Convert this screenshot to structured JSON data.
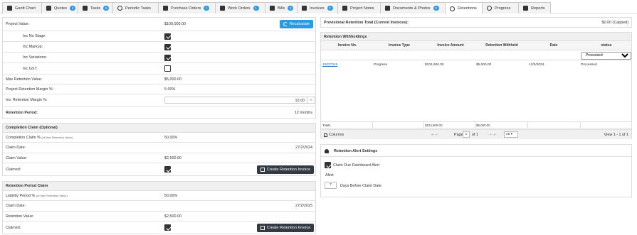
{
  "tabs": [
    {
      "label": "Gantt Chart",
      "icon": "gantt-icon",
      "badge": null
    },
    {
      "label": "Quotes",
      "icon": "quotes-icon",
      "badge": "2"
    },
    {
      "label": "Tasks",
      "icon": "tasks-icon",
      "badge": "6"
    },
    {
      "label": "Periodic Tasks",
      "icon": "periodic-tasks-icon",
      "badge": null
    },
    {
      "label": "Purchase Orders",
      "icon": "cart-icon",
      "badge": "1"
    },
    {
      "label": "Work Orders",
      "icon": "cart-icon",
      "badge": "1"
    },
    {
      "label": "Bills",
      "icon": "cart-icon",
      "badge": "2"
    },
    {
      "label": "Invoices",
      "icon": "invoices-icon",
      "badge": "2"
    },
    {
      "label": "Project Notes",
      "icon": "notes-icon",
      "badge": null
    },
    {
      "label": "Documents & Photos",
      "icon": "documents-icon",
      "badge": "0"
    },
    {
      "label": "Retentions",
      "icon": "sync-icon",
      "badge": null
    },
    {
      "label": "Progress",
      "icon": "progress-icon",
      "badge": null
    },
    {
      "label": "Reports",
      "icon": "reports-icon",
      "badge": null
    }
  ],
  "retention": {
    "project_value_label": "Project Value:",
    "project_value": "$100,000.00",
    "recalculate_label": "Recalculate",
    "inc_no_stage_label": "Inc No Stage:",
    "inc_markup_label": "Inc Markup:",
    "inc_variations_label": "Inc Variations:",
    "inc_gst_label": "Inc GST:",
    "max_retention_label": "Max Retention Value:",
    "max_retention_value": "$5,000.00",
    "margin_label": "Project Retention Margin %:",
    "margin_value": "5.00%",
    "inv_margin_label": "Inv. Retention Margin %:",
    "inv_margin_value": "10.00",
    "pct_symbol": "%",
    "period_label": "Retention Period:",
    "period_value": "12 months"
  },
  "completion": {
    "header": "Completion Claim (Optional)",
    "claim_pct_label": "Completion Claim %",
    "claim_pct_note": "(of Max Retention Value)",
    "claim_pct_value": "50.00%",
    "claim_date_label": "Claim Date:",
    "claim_date_value": "27/2/2024",
    "claim_value_label": "Claim Value:",
    "claim_value_value": "$2,500.00",
    "claimed_label": "Claimed:",
    "create_label": "Create Retention Invoice"
  },
  "period_claim": {
    "header": "Retention Period Claim",
    "liability_label": "Liability Period %",
    "liability_note": "(of Max Retention Value)",
    "liability_value": "50.00%",
    "claim_date_label": "Claim Date:",
    "claim_date_value": "27/2/2025",
    "retention_value_label": "Retention Value:",
    "retention_value_value": "$2,500.00",
    "claimed_label": "Claimed:",
    "create_label": "Create Retention Invoice"
  },
  "provisional": {
    "label": "Provisional Retention Total (Current Invoices):",
    "value": "$0.00 (Capped)"
  },
  "withholdings": {
    "title": "Retention Withholdings",
    "columns": [
      "Invoice No.",
      "Invoice Type",
      "Invoice Amount",
      "Retention Withheld",
      "Date",
      "status"
    ],
    "status_filter": "Processed",
    "rows": [
      {
        "invoice_no": "10027349",
        "type": "Progress",
        "amount": "$104,500.00",
        "withheld": "$5,000.00",
        "date": "12/3/2024",
        "status": "Processed"
      }
    ],
    "totals_label": "Totals",
    "total_amount": "$104,500.00",
    "total_withheld": "$5,000.00",
    "columns_label": "Columns",
    "page_label": "Page",
    "page_value": "1",
    "of_label": "of 1",
    "page_size": "25",
    "view_label": "View 1 - 1 of 1"
  },
  "alerts": {
    "title": "Retention Alert Settings",
    "dashboard_label": "Claim Due Dashboard Alert",
    "alert_label": "Alert:",
    "alert_days": "7",
    "days_label": "Days Before Claim Date"
  }
}
